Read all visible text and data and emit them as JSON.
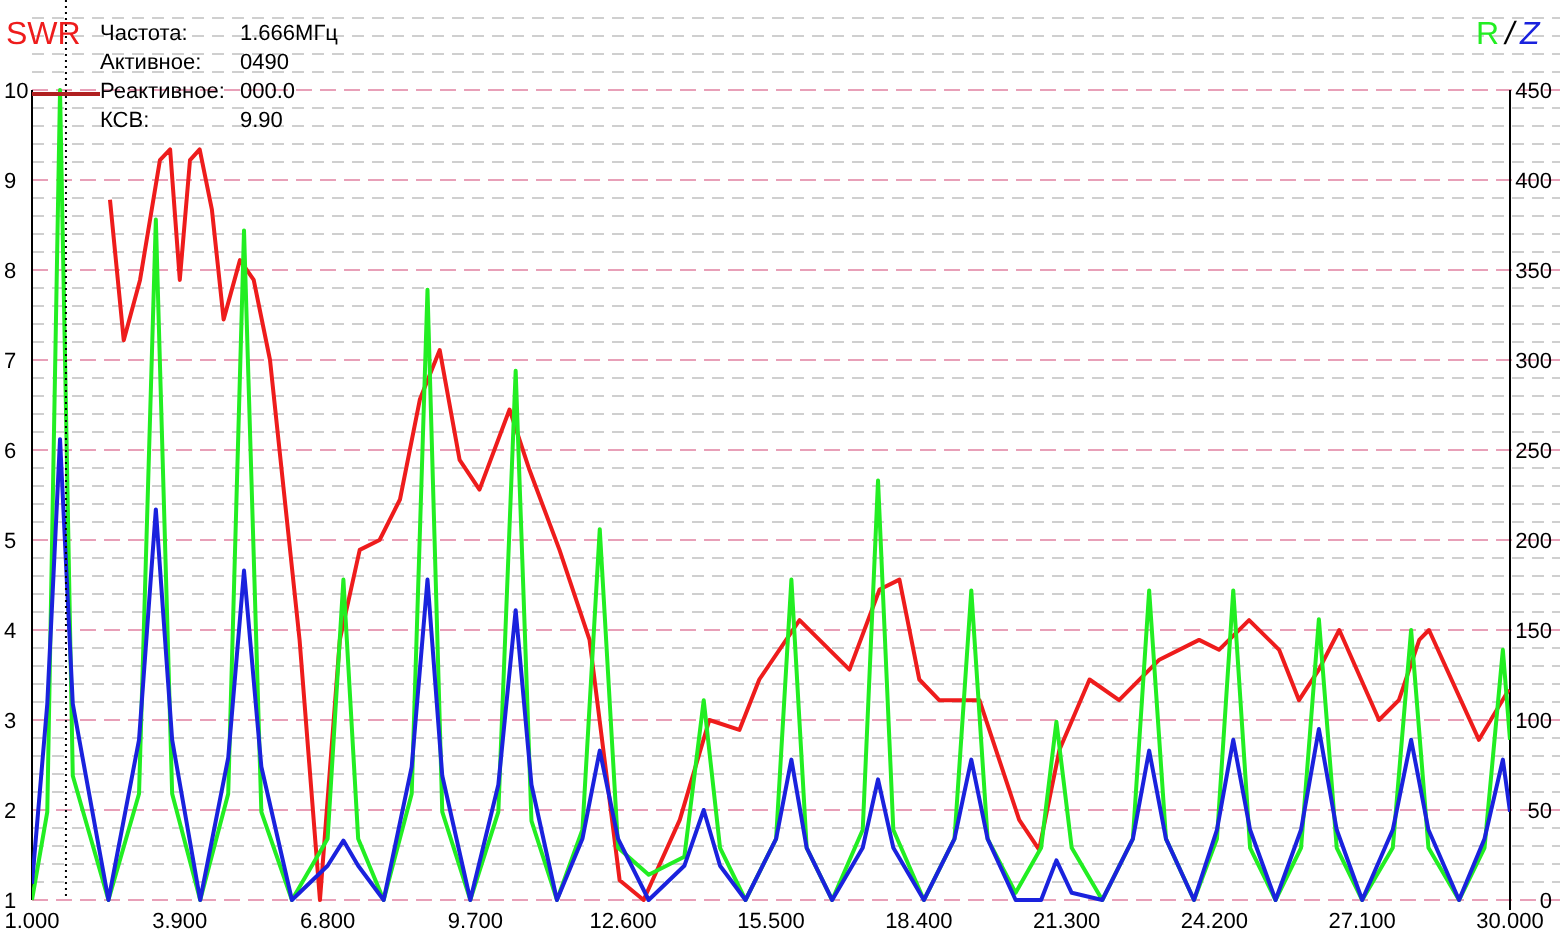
{
  "readout": [
    {
      "label": "Частота:",
      "value": "1.666МГц"
    },
    {
      "label": "Активное:",
      "value": "0490"
    },
    {
      "label": "Реактивное:",
      "value": "000.0"
    },
    {
      "label": "КСВ:",
      "value": "9.90"
    }
  ],
  "axis_separator": "/",
  "chart": {
    "chart_data": {
      "type": "line",
      "xlim": [
        1,
        30
      ],
      "ylim": [
        1,
        10
      ],
      "y2lim": [
        0,
        450
      ],
      "xticks": [
        {
          "value": 1,
          "label": "1.000"
        },
        {
          "value": 3.9,
          "label": "3.900"
        },
        {
          "value": 6.8,
          "label": "6.800"
        },
        {
          "value": 9.7,
          "label": "9.700"
        },
        {
          "value": 12.6,
          "label": "12.600"
        },
        {
          "value": 15.5,
          "label": "15.500"
        },
        {
          "value": 18.4,
          "label": "18.400"
        },
        {
          "value": 21.3,
          "label": "21.300"
        },
        {
          "value": 24.2,
          "label": "24.200"
        },
        {
          "value": 27.1,
          "label": "27.100"
        },
        {
          "value": 30,
          "label": "30.000"
        }
      ],
      "yticks": [
        1,
        2,
        3,
        4,
        5,
        6,
        7,
        8,
        9,
        10
      ],
      "y2ticks": [
        0,
        50,
        100,
        150,
        200,
        250,
        300,
        350,
        400,
        450
      ],
      "grid": true,
      "ref_lines": [
        {
          "axis": "x",
          "value": 1.666
        }
      ],
      "series": [
        {
          "name": "SWR",
          "color": "#ee1c1c",
          "x": [
            2.53,
            2.8,
            3.12,
            3.51,
            3.71,
            3.9,
            4.1,
            4.29,
            4.53,
            4.76,
            5.08,
            5.35,
            5.67,
            6.25,
            6.65,
            7.04,
            7.43,
            7.82,
            8.22,
            8.61,
            9.0,
            9.39,
            9.78,
            10.37,
            10.76,
            11.35,
            11.94,
            12.53,
            13.0,
            13.71,
            14.29,
            14.88,
            15.27,
            16.06,
            16.45,
            17.04,
            17.63,
            18.02,
            18.41,
            18.8,
            19.59,
            20.37,
            20.76,
            21.16,
            21.75,
            22.33,
            23.12,
            23.9,
            24.29,
            24.88,
            25.47,
            25.86,
            26.25,
            26.65,
            27.43,
            27.82,
            28.22,
            28.41,
            29.39,
            29.98
          ],
          "values": [
            8.78,
            7.22,
            7.89,
            9.22,
            9.34,
            7.89,
            9.22,
            9.34,
            8.67,
            7.45,
            8.11,
            7.89,
            7.0,
            3.89,
            1.0,
            3.89,
            4.89,
            5.0,
            5.45,
            6.56,
            7.11,
            5.89,
            5.56,
            6.45,
            5.78,
            4.89,
            3.89,
            1.22,
            1.0,
            1.89,
            3.0,
            2.89,
            3.45,
            4.11,
            3.89,
            3.56,
            4.45,
            4.56,
            3.45,
            3.22,
            3.22,
            1.89,
            1.56,
            2.67,
            3.45,
            3.22,
            3.67,
            3.89,
            3.78,
            4.11,
            3.78,
            3.22,
            3.56,
            4.0,
            3.0,
            3.22,
            3.89,
            4.0,
            2.78,
            3.34
          ]
        },
        {
          "name": "R",
          "color": "#22ee22",
          "axis": "y2",
          "x": [
            1.0,
            1.3,
            1.55,
            1.8,
            2.5,
            3.1,
            3.43,
            3.75,
            4.3,
            4.85,
            5.16,
            5.5,
            6.1,
            6.8,
            7.11,
            7.4,
            7.9,
            8.45,
            8.76,
            9.05,
            9.6,
            10.15,
            10.49,
            10.8,
            11.3,
            11.8,
            12.14,
            12.5,
            13.1,
            13.8,
            14.18,
            14.5,
            15.0,
            15.6,
            15.9,
            16.2,
            16.7,
            17.3,
            17.6,
            17.9,
            18.5,
            19.1,
            19.43,
            19.75,
            20.3,
            20.8,
            21.1,
            21.4,
            22.0,
            22.6,
            22.92,
            23.25,
            23.8,
            24.25,
            24.57,
            24.9,
            25.4,
            25.9,
            26.25,
            26.6,
            27.1,
            27.7,
            28.06,
            28.4,
            29.0,
            29.5,
            29.86,
            30.0
          ],
          "values": [
            0,
            49,
            450,
            69,
            0,
            59,
            378,
            59,
            0,
            59,
            372,
            49,
            0,
            34,
            178,
            34,
            0,
            59,
            339,
            49,
            0,
            49,
            294,
            44,
            0,
            39,
            206,
            29,
            14,
            24,
            111,
            29,
            0,
            34,
            178,
            29,
            0,
            39,
            233,
            39,
            0,
            34,
            172,
            34,
            4,
            29,
            99,
            29,
            0,
            34,
            172,
            34,
            0,
            34,
            172,
            29,
            0,
            29,
            156,
            29,
            0,
            29,
            150,
            29,
            0,
            29,
            139,
            89
          ]
        },
        {
          "name": "Z",
          "color": "#1a22dd",
          "axis": "y2",
          "x": [
            1.0,
            1.3,
            1.55,
            1.8,
            2.5,
            3.1,
            3.43,
            3.75,
            4.3,
            4.85,
            5.16,
            5.5,
            6.1,
            6.8,
            7.11,
            7.4,
            7.9,
            8.45,
            8.76,
            9.05,
            9.6,
            10.15,
            10.49,
            10.8,
            11.3,
            11.8,
            12.14,
            12.5,
            13.1,
            13.8,
            14.18,
            14.5,
            15.0,
            15.6,
            15.9,
            16.2,
            16.7,
            17.3,
            17.6,
            17.9,
            18.5,
            19.1,
            19.43,
            19.75,
            20.3,
            20.8,
            21.1,
            21.4,
            22.0,
            22.6,
            22.92,
            23.25,
            23.8,
            24.25,
            24.57,
            24.9,
            25.4,
            25.9,
            26.25,
            26.6,
            27.1,
            27.7,
            28.06,
            28.4,
            29.0,
            29.5,
            29.86,
            30.0
          ],
          "values": [
            9,
            109,
            256,
            109,
            0,
            89,
            217,
            89,
            0,
            79,
            183,
            74,
            0,
            19,
            33,
            19,
            0,
            74,
            178,
            69,
            0,
            64,
            161,
            64,
            0,
            34,
            83,
            34,
            0,
            19,
            50,
            19,
            0,
            34,
            78,
            29,
            0,
            29,
            67,
            29,
            0,
            34,
            78,
            34,
            0,
            0,
            22,
            4,
            0,
            34,
            83,
            34,
            0,
            39,
            89,
            39,
            0,
            39,
            95,
            39,
            0,
            39,
            89,
            39,
            0,
            34,
            78,
            49
          ]
        }
      ]
    }
  }
}
